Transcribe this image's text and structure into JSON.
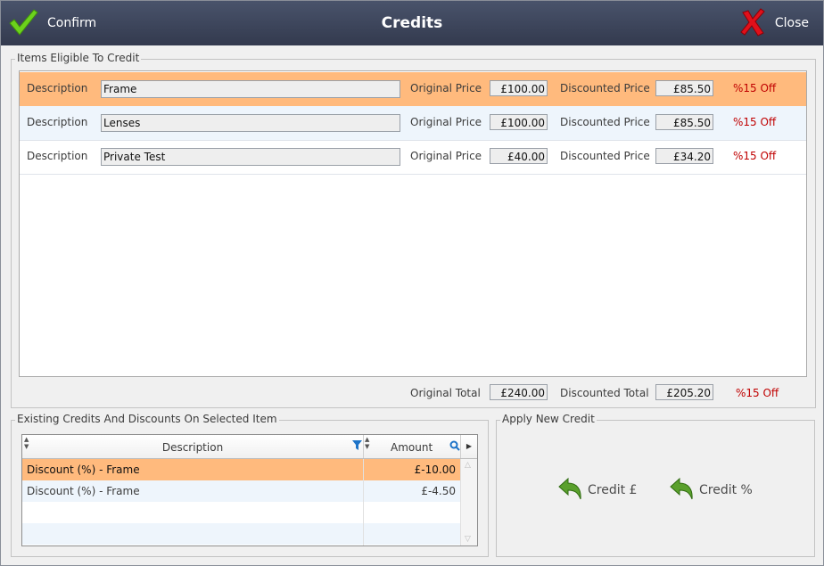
{
  "window": {
    "title": "Credits"
  },
  "toolbar": {
    "confirm_label": "Confirm",
    "close_label": "Close"
  },
  "items_group": {
    "legend": "Items Eligible To Credit",
    "rows": [
      {
        "desc_label": "Description",
        "description": "Frame",
        "orig_label": "Original Price",
        "original_price": "£100.00",
        "disc_label": "Discounted Price",
        "discounted_price": "£85.50",
        "off": "%15 Off"
      },
      {
        "desc_label": "Description",
        "description": "Lenses",
        "orig_label": "Original Price",
        "original_price": "£100.00",
        "disc_label": "Discounted Price",
        "discounted_price": "£85.50",
        "off": "%15 Off"
      },
      {
        "desc_label": "Description",
        "description": "Private Test",
        "orig_label": "Original Price",
        "original_price": "£40.00",
        "disc_label": "Discounted Price",
        "discounted_price": "£34.20",
        "off": "%15 Off"
      }
    ],
    "totals": {
      "orig_label": "Original Total",
      "original_total": "£240.00",
      "disc_label": "Discounted Total",
      "discounted_total": "£205.20",
      "off": "%15 Off"
    }
  },
  "existing_group": {
    "legend": "Existing Credits And Discounts On Selected Item",
    "columns": {
      "description": "Description",
      "amount": "Amount"
    },
    "rows": [
      {
        "description": "Discount (%) - Frame",
        "amount": "£-10.00"
      },
      {
        "description": "Discount (%) - Frame",
        "amount": "£-4.50"
      }
    ]
  },
  "apply_group": {
    "legend": "Apply New Credit",
    "credit_pound_label": "Credit £",
    "credit_percent_label": "Credit %"
  },
  "colors": {
    "selected_row": "#ffba7d",
    "alt_row": "#eef5fc",
    "titlebar": "#3a4259",
    "off_text": "#c00000"
  }
}
